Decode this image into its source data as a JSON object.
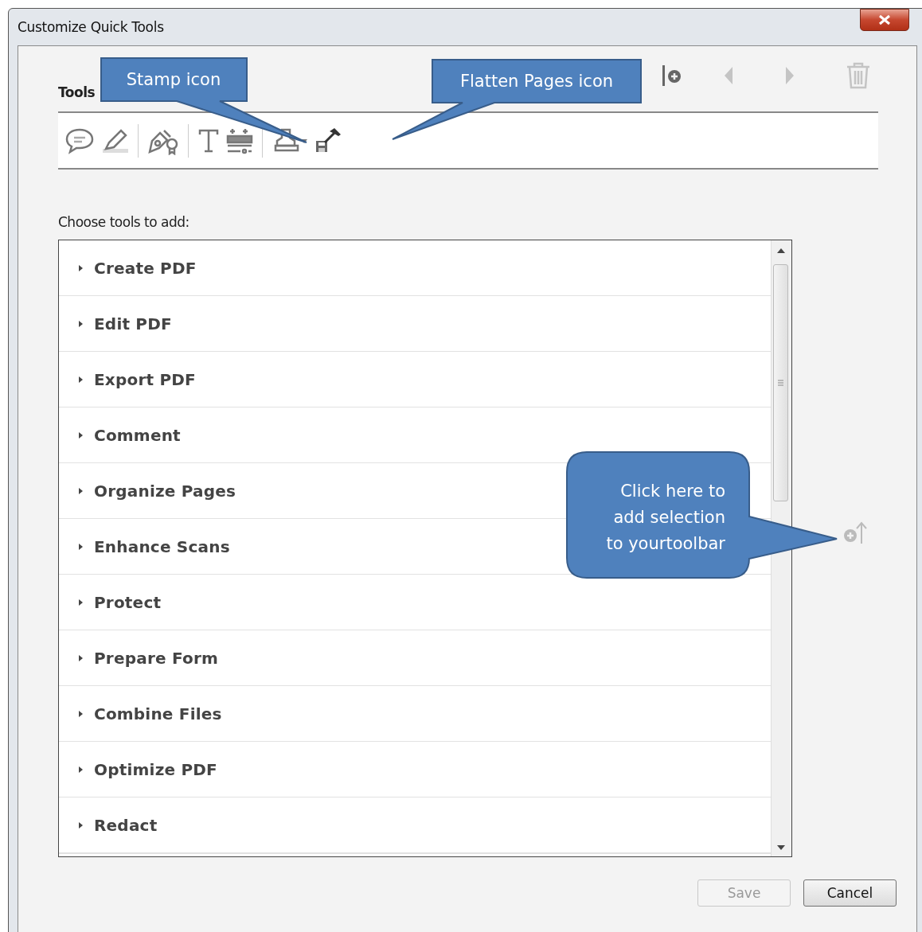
{
  "window": {
    "title": "Customize Quick Tools"
  },
  "toolbar_label": "Tools",
  "toolbar_actions": [
    {
      "kind": "add",
      "disabled": false
    },
    {
      "kind": "left",
      "disabled": true
    },
    {
      "kind": "right",
      "disabled": true
    },
    {
      "kind": "delete",
      "disabled": true
    }
  ],
  "toolbar_tools": [
    {
      "kind": "comment"
    },
    {
      "kind": "highlight"
    },
    {
      "kind": "sign"
    },
    {
      "kind": "text"
    },
    {
      "kind": "insert"
    },
    {
      "kind": "stamp"
    },
    {
      "kind": "flatten"
    }
  ],
  "choose_label": "Choose tools to add:",
  "tool_groups": [
    {
      "label": "Create PDF",
      "expanded": false
    },
    {
      "label": "Edit PDF",
      "expanded": false
    },
    {
      "label": "Export PDF",
      "expanded": false
    },
    {
      "label": "Comment",
      "expanded": false
    },
    {
      "label": "Organize Pages",
      "expanded": false
    },
    {
      "label": "Enhance Scans",
      "expanded": false
    },
    {
      "label": "Protect",
      "expanded": false
    },
    {
      "label": "Prepare Form",
      "expanded": false
    },
    {
      "label": "Combine Files",
      "expanded": false
    },
    {
      "label": "Optimize PDF",
      "expanded": false
    },
    {
      "label": "Redact",
      "expanded": false
    }
  ],
  "add_to_toolbar": {
    "disabled": true
  },
  "callouts": [
    {
      "kind": "stamp",
      "text": "Stamp icon"
    },
    {
      "kind": "flatten",
      "text": "Flatten Pages icon"
    },
    {
      "kind": "add",
      "text": "Click here to add selection to yourtoolbar"
    }
  ],
  "buttons": [
    {
      "label": "Save",
      "disabled": true
    },
    {
      "label": "Cancel",
      "disabled": false
    }
  ]
}
